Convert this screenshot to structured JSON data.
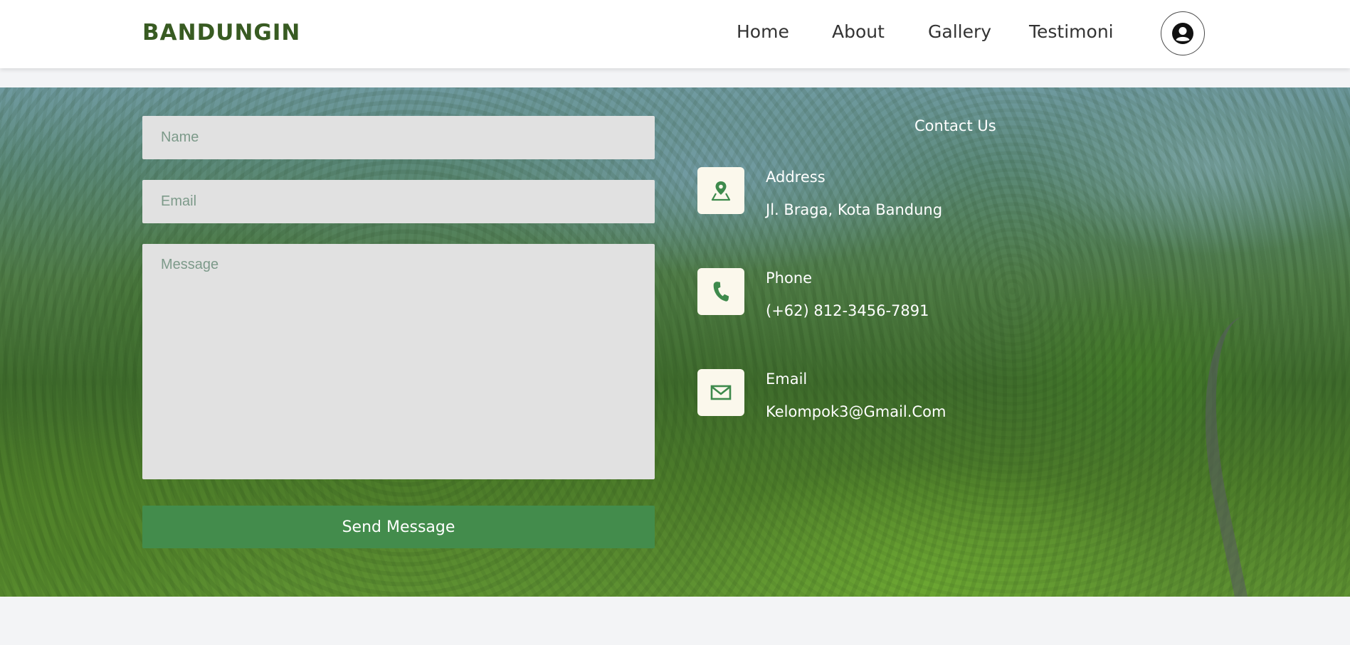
{
  "navbar": {
    "brand": "BANDUNGIN",
    "links": [
      {
        "label": "Home"
      },
      {
        "label": "About"
      },
      {
        "label": "Gallery"
      },
      {
        "label": "Testimoni"
      }
    ],
    "avatar_icon": "user-circle-icon"
  },
  "form": {
    "name_placeholder": "Name",
    "email_placeholder": "Email",
    "message_placeholder": "Message",
    "send_label": "Send Message"
  },
  "contact": {
    "title": "Contact Us",
    "items": [
      {
        "label": "Address",
        "value": "Jl. Braga, Kota Bandung",
        "icon": "map-pin-icon"
      },
      {
        "label": "Phone",
        "value": "(+62) 812-3456-7891",
        "icon": "phone-icon"
      },
      {
        "label": "Email",
        "value": "Kelompok3@Gmail.Com",
        "icon": "mail-icon"
      }
    ]
  },
  "colors": {
    "brand": "#385b22",
    "button": "#438c4c",
    "icon_green": "#3e8a4c",
    "field_bg": "#e1e1e1"
  }
}
